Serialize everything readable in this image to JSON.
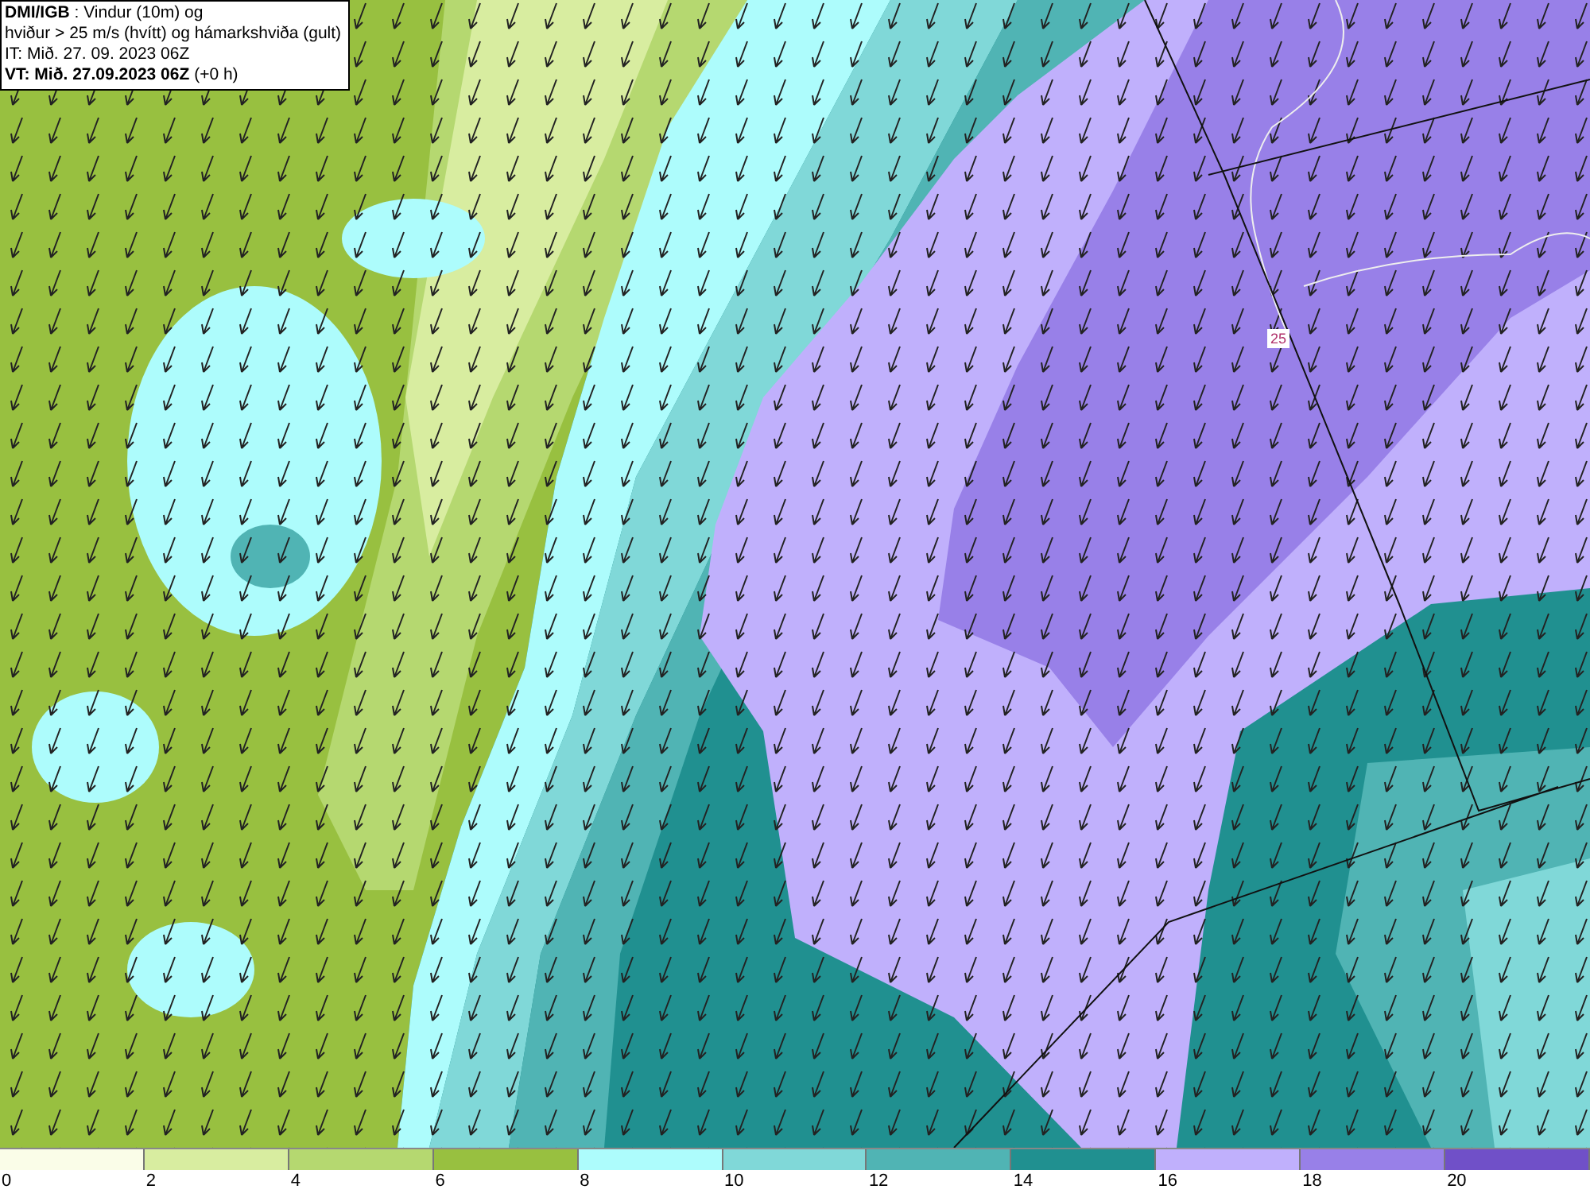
{
  "title_box": {
    "lines": [
      "**DMI/IGB** : Vindur (10m) og",
      "hviður > 25 m/s (hvítt) og hámarkshviða (gult)",
      "IT: Mið. 27. 09. 2023 06Z",
      "**VT: Mið. 27.09.2023 06Z** (+0 h)"
    ]
  },
  "map": {
    "contour_label": "25"
  },
  "legend": [
    {
      "label": "0",
      "color": "#fafde8"
    },
    {
      "label": "2",
      "color": "#d8eda0"
    },
    {
      "label": "4",
      "color": "#b5d870"
    },
    {
      "label": "6",
      "color": "#98c040"
    },
    {
      "label": "8",
      "color": "#adfcfc"
    },
    {
      "label": "10",
      "color": "#80d8d8"
    },
    {
      "label": "12",
      "color": "#50b4b4"
    },
    {
      "label": "14",
      "color": "#209090"
    },
    {
      "label": "16",
      "color": "#c0b0fc"
    },
    {
      "label": "18",
      "color": "#9880e8"
    },
    {
      "label": "20",
      "color": "#7050c8"
    }
  ]
}
